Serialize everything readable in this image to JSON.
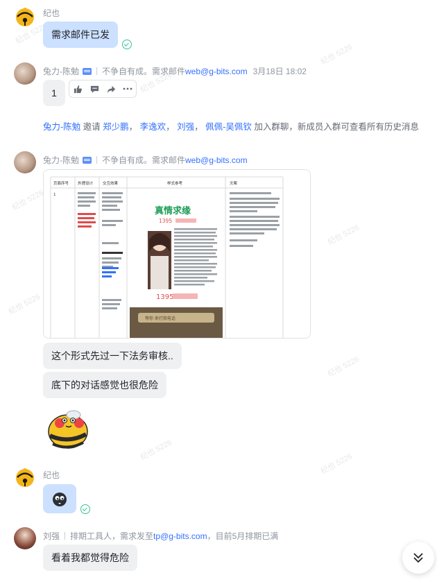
{
  "messages": {
    "m1": {
      "sender": "纪也",
      "text": "需求邮件已发"
    },
    "m2": {
      "sender": "兔力-陈勉",
      "signature_prefix": "不争自有成。需求邮件",
      "email": "web@g-bits.com",
      "time": "3月18日 18:02",
      "text": "1"
    },
    "system_join": {
      "inviter": "兔力-陈勉",
      "invite_word": "邀请",
      "invitees": [
        "郑少鹏",
        "李逸欢",
        "刘强",
        "佩佩-吴佩钦"
      ],
      "suffix": "加入群聊，新成员入群可查看所有历史消息"
    },
    "m3": {
      "sender": "兔力-陈勉",
      "signature_prefix": "不争自有成。需求邮件",
      "email": "web@g-bits.com",
      "image": {
        "headers": [
          "页面序号",
          "外理设计",
          "交互效果",
          "样式参考",
          "文案"
        ],
        "row_no": "1",
        "poster_title": "真情求缘",
        "poster_phone": "1395",
        "poster_dialog": "等你 来打我电话"
      },
      "text1": "这个形式先过一下法务审核..",
      "text2": "底下的对话感觉也很危险"
    },
    "m4": {
      "sender": "纪也"
    },
    "m5": {
      "sender": "刘强",
      "signature_prefix": "排期工具人，需求发至",
      "email": "tp@g-bits.com",
      "signature_suffix": "，目前5月排期已满",
      "text": "看着我都觉得危险"
    }
  },
  "watermark": "纪也 5226",
  "colors": {
    "blue_bubble": "#cce0ff",
    "grey_bubble": "#eff0f1",
    "link": "#3370ff",
    "read": "#34c29a"
  }
}
